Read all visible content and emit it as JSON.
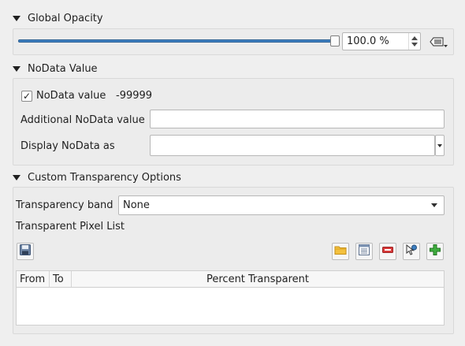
{
  "sections": {
    "global_opacity": {
      "title": "Global Opacity",
      "value_text": "100.0 %",
      "level": 1.0
    },
    "nodata": {
      "title": "NoData Value",
      "checkbox_label": "NoData value",
      "checked_mark": "✓",
      "nodata_value": "-99999",
      "additional_label": "Additional NoData value",
      "additional_value": "",
      "display_label": "Display NoData as"
    },
    "custom_transparency": {
      "title": "Custom Transparency Options",
      "band_label": "Transparency band",
      "band_value": "None",
      "pixel_list_label": "Transparent Pixel List",
      "table_headers": [
        "From",
        "To",
        "Percent Transparent"
      ],
      "table_rows": []
    }
  },
  "icons": {
    "data_defined": "data-defined-override-icon",
    "save": "save-icon",
    "open": "folder-open-icon",
    "default_values": "table-values-icon",
    "remove": "remove-icon",
    "pick": "pick-values-from-map-icon",
    "add": "add-icon"
  },
  "colors": {
    "accent": "#3d7fc1",
    "add_green": "#2e9a2e",
    "remove_red": "#d83a3a"
  }
}
